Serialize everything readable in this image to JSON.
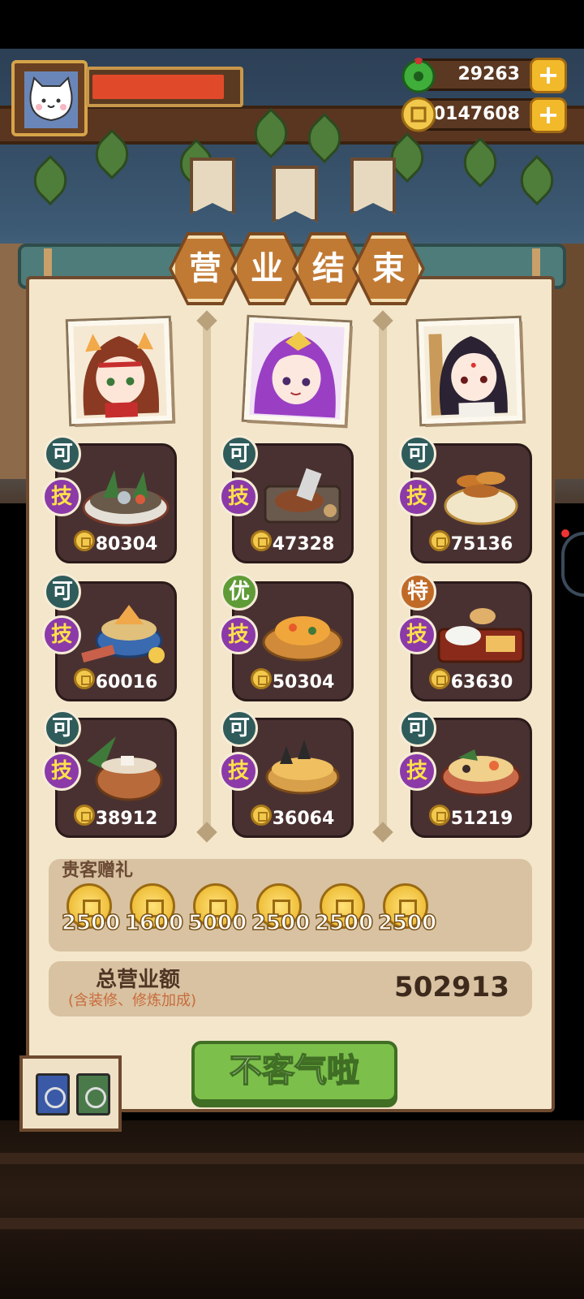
{
  "hud": {
    "jade": "29263",
    "gold": "20147608",
    "hp_fraction": 0.91
  },
  "panel": {
    "title_chars": [
      "营",
      "业",
      "结",
      "束"
    ]
  },
  "chefs": [
    {
      "name": "chef-red-hair",
      "dishes": [
        {
          "grade": "可",
          "grade_color": "#2f5b5b",
          "skill": "技",
          "price": "80304"
        },
        {
          "grade": "可",
          "grade_color": "#2f5b5b",
          "skill": "技",
          "price": "60016"
        },
        {
          "grade": "可",
          "grade_color": "#2f5b5b",
          "skill": "技",
          "price": "38912"
        }
      ]
    },
    {
      "name": "chef-purple-hair",
      "dishes": [
        {
          "grade": "可",
          "grade_color": "#2f5b5b",
          "skill": "技",
          "price": "47328"
        },
        {
          "grade": "优",
          "grade_color": "#5f9b37",
          "skill": "技",
          "price": "50304"
        },
        {
          "grade": "可",
          "grade_color": "#2f5b5b",
          "skill": "技",
          "price": "36064"
        }
      ]
    },
    {
      "name": "chef-black-hair",
      "dishes": [
        {
          "grade": "可",
          "grade_color": "#2f5b5b",
          "skill": "技",
          "price": "75136"
        },
        {
          "grade": "特",
          "grade_color": "#c06a28",
          "skill": "技",
          "price": "63630"
        },
        {
          "grade": "可",
          "grade_color": "#2f5b5b",
          "skill": "技",
          "price": "51219"
        }
      ]
    }
  ],
  "gifts": {
    "title": "贵客赠礼",
    "values": [
      "2500",
      "1600",
      "5000",
      "2500",
      "2500",
      "2500"
    ]
  },
  "total": {
    "label": "总营业额",
    "note": "(含装修、修炼加成)",
    "value": "502913"
  },
  "confirm_label": "不客气啦",
  "colors": {
    "panel": "#f3e6cb",
    "dish_card": "#4a3131",
    "button": "#7cbf4b",
    "skill_badge": "#8b3aa8"
  }
}
